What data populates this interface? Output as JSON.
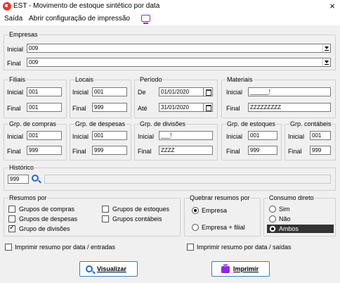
{
  "window": {
    "title": "EST - Movimento de estoque sintético por data",
    "close": "×"
  },
  "menu": {
    "saida": "Saída",
    "abrir_config": "Abrir configuração de impressão"
  },
  "labels": {
    "inicial": "Inicial",
    "final": "Final",
    "de": "De",
    "ate": "Até"
  },
  "empresas": {
    "legend": "Empresas",
    "inicial": "009",
    "final": "009"
  },
  "filiais": {
    "legend": "Filiais",
    "inicial": "001",
    "final": "001"
  },
  "locais": {
    "legend": "Locais",
    "inicial": "001",
    "final": "999"
  },
  "periodo": {
    "legend": "Período",
    "de": "01/01/2020",
    "ate": "31/01/2020"
  },
  "materiais": {
    "legend": "Materiais",
    "inicial": "______!",
    "final": "ZZZZZZZZZ"
  },
  "grp_compras": {
    "legend": "Grp. de compras",
    "inicial": "001",
    "final": "999"
  },
  "grp_despesas": {
    "legend": "Grp. de despesas",
    "inicial": "001",
    "final": "999"
  },
  "grp_divisoes": {
    "legend": "Grp. de divisões",
    "inicial": "___!",
    "final": "ZZZZ"
  },
  "grp_estoques": {
    "legend": "Grp. de estoques",
    "inicial": "001",
    "final": "999"
  },
  "grp_contabeis": {
    "legend": "Grp. contábeis",
    "inicial": "001",
    "final": "999"
  },
  "historico": {
    "legend": "Histórico",
    "code": "999",
    "desc": ""
  },
  "resumos_por": {
    "legend": "Resumos por",
    "compras": "Grupos de compras",
    "despesas": "Grupos de despesas",
    "divisoes": "Grupo de divisões",
    "estoques": "Grupos de estoques",
    "contabeis": "Grupos contábeis"
  },
  "quebrar": {
    "legend": "Quebrar resumos por",
    "empresa": "Empresa",
    "empresa_filial": "Empresa + filial"
  },
  "consumo": {
    "legend": "Consumo direto",
    "sim": "Sim",
    "nao": "Não",
    "ambos": "Ambos"
  },
  "imprimir_entradas": "Imprimir resumo por data / entradas",
  "imprimir_saidas": "Imprimir resumo por data / saídas",
  "buttons": {
    "visualizar": "Visualizar",
    "imprimir": "Imprimir"
  },
  "colors": {
    "accent_blue": "#2b63d9",
    "printer_purple": "#8a2be2",
    "app_red": "#e53935"
  }
}
